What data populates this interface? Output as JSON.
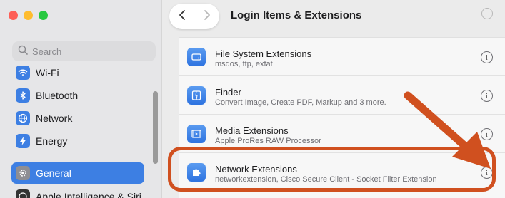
{
  "window": {
    "title": "Login Items & Extensions"
  },
  "sidebar": {
    "search_placeholder": "Search",
    "items": [
      {
        "label": "Wi-Fi",
        "icon": "wifi-icon",
        "color": "#3d7fe3"
      },
      {
        "label": "Bluetooth",
        "icon": "bluetooth-icon",
        "color": "#3d7fe3"
      },
      {
        "label": "Network",
        "icon": "globe-icon",
        "color": "#3d7fe3"
      },
      {
        "label": "Energy",
        "icon": "bolt-icon",
        "color": "#3d7fe3"
      },
      {
        "label": "General",
        "icon": "gear-icon",
        "color": "#8e8e93",
        "active": true
      },
      {
        "label": "Apple Intelligence & Siri",
        "icon": "siri-icon",
        "color": "#333333"
      }
    ]
  },
  "rows": [
    {
      "title": "File System Extensions",
      "subtitle": "msdos, ftp, exfat",
      "icon": "drive-icon"
    },
    {
      "title": "Finder",
      "subtitle": "Convert Image, Create PDF, Markup and 3 more.",
      "icon": "finder-icon"
    },
    {
      "title": "Media Extensions",
      "subtitle": "Apple ProRes RAW Processor",
      "icon": "media-icon"
    },
    {
      "title": "Network Extensions",
      "subtitle": "networkextension, Cisco Secure Client - Socket Filter Extension",
      "icon": "puzzle-icon"
    }
  ],
  "info_glyph": "i",
  "annotation": {
    "color": "#d0501f"
  }
}
